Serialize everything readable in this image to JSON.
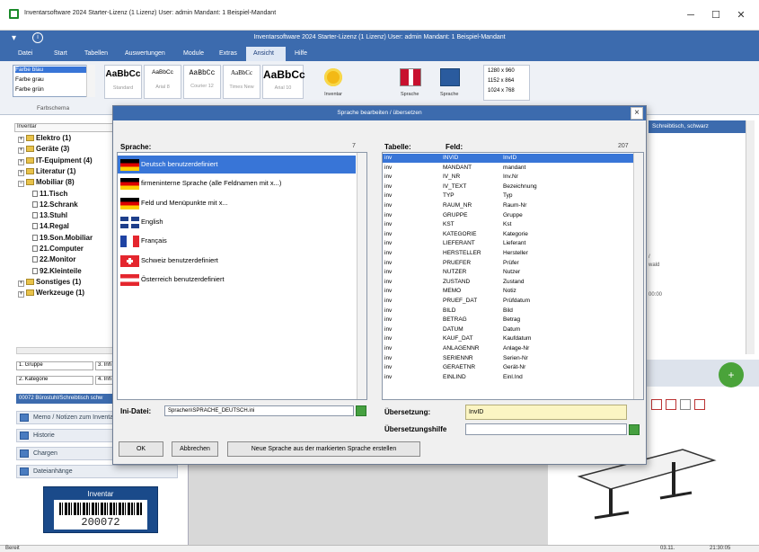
{
  "window": {
    "title": "Inventarsoftware 2024 Starter-Lizenz (1 Lizenz)  User: admin  Mandant: 1 Beispiel-Mandant",
    "minimize": "─",
    "maximize": "☐",
    "close": "✕"
  },
  "ribbon": {
    "caption": "Inventarsoftware 2024 Starter-Lizenz (1 Lizenz)   User: admin   Mandant: 1 Beispiel-Mandant",
    "menu": [
      "Datei",
      "Start",
      "Tabellen",
      "Auswertungen",
      "Module",
      "Extras",
      "Ansicht",
      "Hilfe"
    ],
    "active_menu": "Ansicht"
  },
  "toolbar": {
    "color_list": [
      "Farbe blau",
      "Farbe grau",
      "Farbe grün"
    ],
    "farbschema_label": "Farbschema",
    "styles": [
      {
        "preview": "AaBbCc",
        "name": "Standard"
      },
      {
        "preview": "AaBbCc",
        "name": "Arial 8"
      },
      {
        "preview": "AaBbCc",
        "name": "Courier 12"
      },
      {
        "preview": "AaBbCc",
        "name": "Times New"
      },
      {
        "preview": "AaBbCc",
        "name": "Arial 10"
      }
    ],
    "inventar_label": "Inventar",
    "sprache1_label": "Sprache",
    "sprache2_label": "Sprache",
    "resolutions": [
      "1280 x 960",
      "1152 x 864",
      "1024 x 768"
    ]
  },
  "left": {
    "tree_header": "Inventar",
    "tree": [
      {
        "label": "Elektro  (1)",
        "exp": "+",
        "indent": 0
      },
      {
        "label": "Geräte  (3)",
        "exp": "+",
        "indent": 0
      },
      {
        "label": "IT-Equipment  (4)",
        "exp": "+",
        "indent": 0
      },
      {
        "label": "Literatur  (1)",
        "exp": "+",
        "indent": 0
      },
      {
        "label": "Mobiliar  (8)",
        "exp": "−",
        "indent": 0
      },
      {
        "label": "11.Tisch",
        "exp": "",
        "indent": 1
      },
      {
        "label": "12.Schrank",
        "exp": "",
        "indent": 1
      },
      {
        "label": "13.Stuhl",
        "exp": "",
        "indent": 1
      },
      {
        "label": "14.Regal",
        "exp": "",
        "indent": 1
      },
      {
        "label": "19.Son.Mobiliar",
        "exp": "",
        "indent": 1
      },
      {
        "label": "21.Computer",
        "exp": "",
        "indent": 1
      },
      {
        "label": "22.Monitor",
        "exp": "",
        "indent": 1
      },
      {
        "label": "92.Kleinteile",
        "exp": "",
        "indent": 1
      },
      {
        "label": "Sonstiges  (1)",
        "exp": "+",
        "indent": 0
      },
      {
        "label": "Werkzeuge  (1)",
        "exp": "+",
        "indent": 0
      }
    ],
    "combo1": "1. Gruppe",
    "combo1b": "3. Inh",
    "combo2": "2. Kategorie",
    "combo2b": "4. Inh",
    "section_title": "00072 Bürostuhl/Schreibtisch schw",
    "side_buttons": [
      "Memo / Notizen zum Inventar",
      "Historie",
      "Chargen",
      "Dateianhänge"
    ],
    "barcode_label": "Inventar",
    "barcode_number": "200072"
  },
  "right": {
    "header": "Schreibtisch, schwarz",
    "text1": "/",
    "text2": "wald",
    "text3": "00:00"
  },
  "status": {
    "left": "Bereit",
    "right1": "03.11.",
    "right2": "21:30:05"
  },
  "dialog": {
    "title": "Sprache bearbeiten / übersetzen",
    "close": "×",
    "sprache_label": "Sprache:",
    "sprache_count": "7",
    "languages": [
      {
        "label": "Deutsch benutzerdefiniert",
        "flag": "de",
        "selected": true
      },
      {
        "label": "firmeninterne Sprache (alle Feldnamen mit x...)",
        "flag": "de",
        "selected": false
      },
      {
        "label": "Feld und Menüpunkte mit x...",
        "flag": "de",
        "selected": false
      },
      {
        "label": "English",
        "flag": "uk",
        "selected": false
      },
      {
        "label": "Français",
        "flag": "fr",
        "selected": false
      },
      {
        "label": "Schweiz benutzerdefiniert",
        "flag": "ch",
        "selected": false
      },
      {
        "label": "Österreich benutzerdefiniert",
        "flag": "at",
        "selected": false
      }
    ],
    "ini_label": "Ini-Datei:",
    "ini_value": "Sprachen\\SPRACHE_DEUTSCH.ini",
    "ok_label": "OK",
    "cancel_label": "Abbrechen",
    "new_lang_label": "Neue Sprache aus der markierten Sprache erstellen",
    "tabelle_label": "Tabelle:",
    "feld_label": "Feld:",
    "feld_count": "207",
    "rows": [
      {
        "t": "inv",
        "f": "INVID",
        "v": "InvID",
        "selected": true
      },
      {
        "t": "inv",
        "f": "MANDANT",
        "v": "mandant",
        "selected": false
      },
      {
        "t": "inv",
        "f": "IV_NR",
        "v": "Inv.Nr",
        "selected": false
      },
      {
        "t": "inv",
        "f": "IV_TEXT",
        "v": "Bezeichnung",
        "selected": false
      },
      {
        "t": "inv",
        "f": "TYP",
        "v": "Typ",
        "selected": false
      },
      {
        "t": "inv",
        "f": "RAUM_NR",
        "v": "Raum-Nr",
        "selected": false
      },
      {
        "t": "inv",
        "f": "GRUPPE",
        "v": "Gruppe",
        "selected": false
      },
      {
        "t": "inv",
        "f": "KST",
        "v": "Kst",
        "selected": false
      },
      {
        "t": "inv",
        "f": "KATEGORIE",
        "v": "Kategorie",
        "selected": false
      },
      {
        "t": "inv",
        "f": "LIEFERANT",
        "v": "Lieferant",
        "selected": false
      },
      {
        "t": "inv",
        "f": "HERSTELLER",
        "v": "Hersteller",
        "selected": false
      },
      {
        "t": "inv",
        "f": "PRUEFER",
        "v": "Prüfer",
        "selected": false
      },
      {
        "t": "inv",
        "f": "NUTZER",
        "v": "Nutzer",
        "selected": false
      },
      {
        "t": "inv",
        "f": "ZUSTAND",
        "v": "Zustand",
        "selected": false
      },
      {
        "t": "inv",
        "f": "MEMO",
        "v": "Notiz",
        "selected": false
      },
      {
        "t": "inv",
        "f": "PRUEF_DAT",
        "v": "Prüfdatum",
        "selected": false
      },
      {
        "t": "inv",
        "f": "BILD",
        "v": "Bild",
        "selected": false
      },
      {
        "t": "inv",
        "f": "BETRAG",
        "v": "Betrag",
        "selected": false
      },
      {
        "t": "inv",
        "f": "DATUM",
        "v": "Datum",
        "selected": false
      },
      {
        "t": "inv",
        "f": "KAUF_DAT",
        "v": "Kaufdatum",
        "selected": false
      },
      {
        "t": "inv",
        "f": "ANLAGENNR",
        "v": "Anlage-Nr",
        "selected": false
      },
      {
        "t": "inv",
        "f": "SERIENNR",
        "v": "Serien-Nr",
        "selected": false
      },
      {
        "t": "inv",
        "f": "GERAETNR",
        "v": "Gerät-Nr",
        "selected": false
      },
      {
        "t": "inv",
        "f": "EINLIND",
        "v": "Einl.Ind",
        "selected": false
      }
    ],
    "ueb_label": "Übersetzung:",
    "ueb_value": "InvID",
    "ueb_hilfe_label": "Übersetzungshilfe",
    "ueb_hilfe_value": ""
  },
  "colors": {
    "ribbon": "#3c6bae",
    "selection": "#3875d7",
    "translation_bg": "#fbf5c3"
  }
}
